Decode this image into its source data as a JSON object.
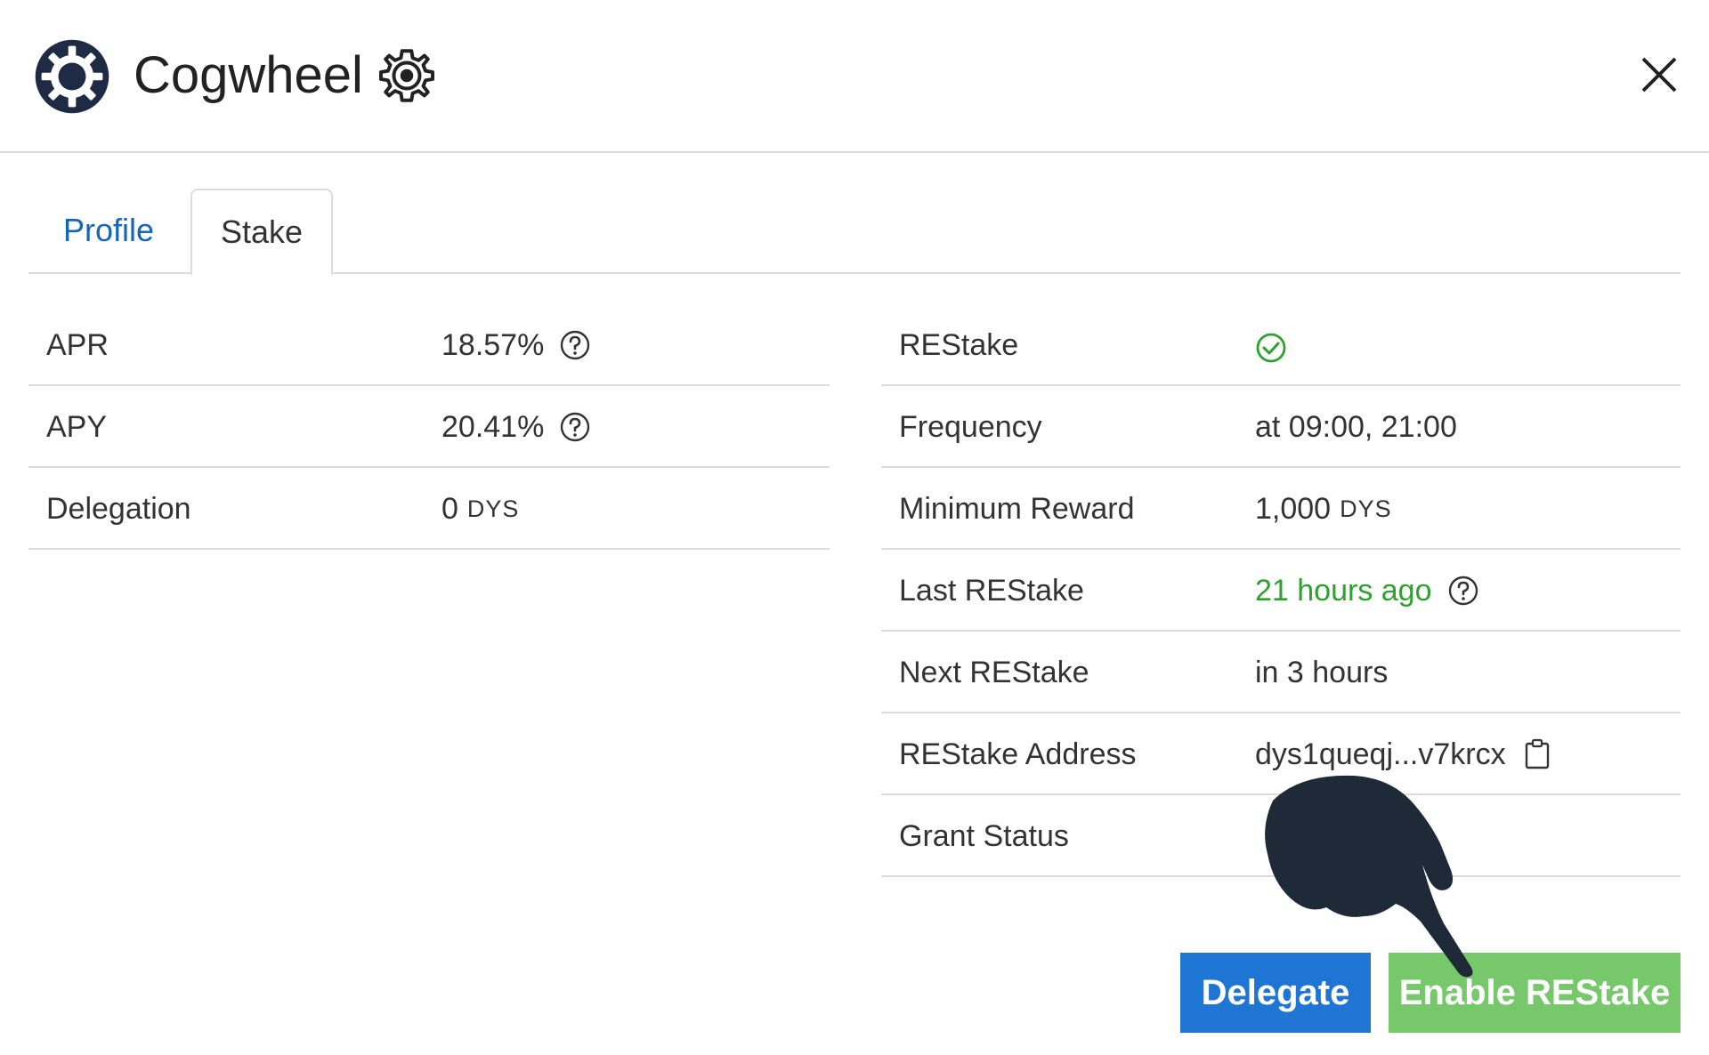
{
  "header": {
    "title": "Cogwheel",
    "logo_icon": "cogwheel-logo-icon",
    "badge_icon": "gear-outline-icon",
    "close_icon": "close-icon"
  },
  "tabs": [
    {
      "label": "Profile",
      "active": false
    },
    {
      "label": "Stake",
      "active": true
    }
  ],
  "left_table": {
    "apr": {
      "label": "APR",
      "value": "18.57%"
    },
    "apy": {
      "label": "APY",
      "value": "20.41%"
    },
    "delegation": {
      "label": "Delegation",
      "value": "0",
      "unit": "DYS"
    }
  },
  "right_table": {
    "restake": {
      "label": "REStake",
      "status_icon": "check-circle-icon"
    },
    "frequency": {
      "label": "Frequency",
      "value": "at 09:00, 21:00"
    },
    "minimum_reward": {
      "label": "Minimum Reward",
      "value": "1,000",
      "unit": "DYS"
    },
    "last_restake": {
      "label": "Last REStake",
      "value": "21 hours ago"
    },
    "next_restake": {
      "label": "Next REStake",
      "value": "in 3 hours"
    },
    "restake_address": {
      "label": "REStake Address",
      "value": "dys1queqj...v7krcx"
    },
    "grant_status": {
      "label": "Grant Status",
      "value": ""
    }
  },
  "buttons": {
    "delegate": "Delegate",
    "enable_restake": "Enable REStake"
  },
  "colors": {
    "link_blue": "#1565b8",
    "delegate_blue": "#1f75d3",
    "restake_green": "#76c86a",
    "success_green": "#2ea12e",
    "logo_navy": "#1f2a44"
  }
}
